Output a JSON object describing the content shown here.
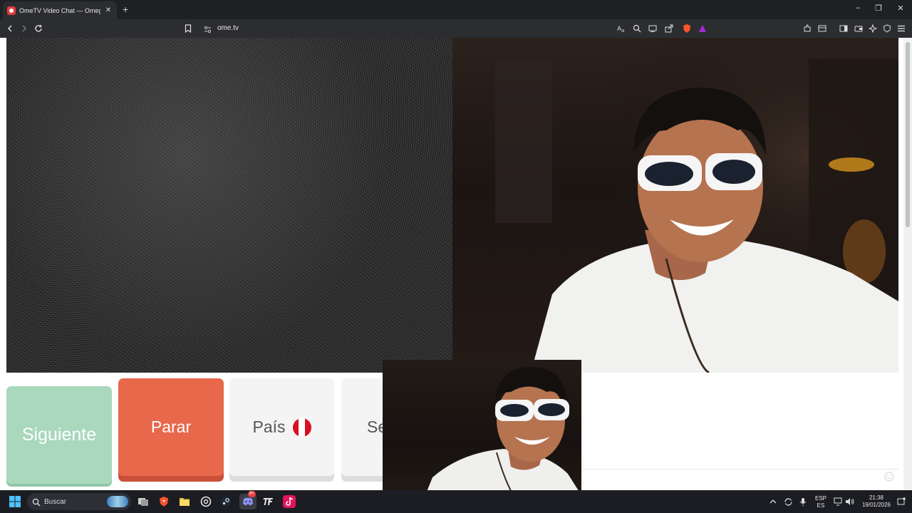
{
  "browser": {
    "tab_title": "OmeTV Video Chat — Omegle",
    "new_tab": "+",
    "tab_close": "✕",
    "url": "ome.tv",
    "win_min": "–",
    "win_max": "❐",
    "win_close": "✕"
  },
  "controls": {
    "next_label": "Siguiente",
    "stop_label": "Parar",
    "country_label": "País",
    "gender_label": "Sexo",
    "country_flag_colors": [
      "#d91023",
      "#ffffff",
      "#d91023"
    ]
  },
  "taskbar": {
    "search_placeholder": "Buscar",
    "lang_top": "ESP",
    "lang_bottom": "ES",
    "time": "21:38",
    "date": "19/01/2026",
    "discord_badge": "9+"
  },
  "colors": {
    "next": "#a9d8bd",
    "stop": "#e8684c",
    "neutral": "#f4f4f4"
  }
}
